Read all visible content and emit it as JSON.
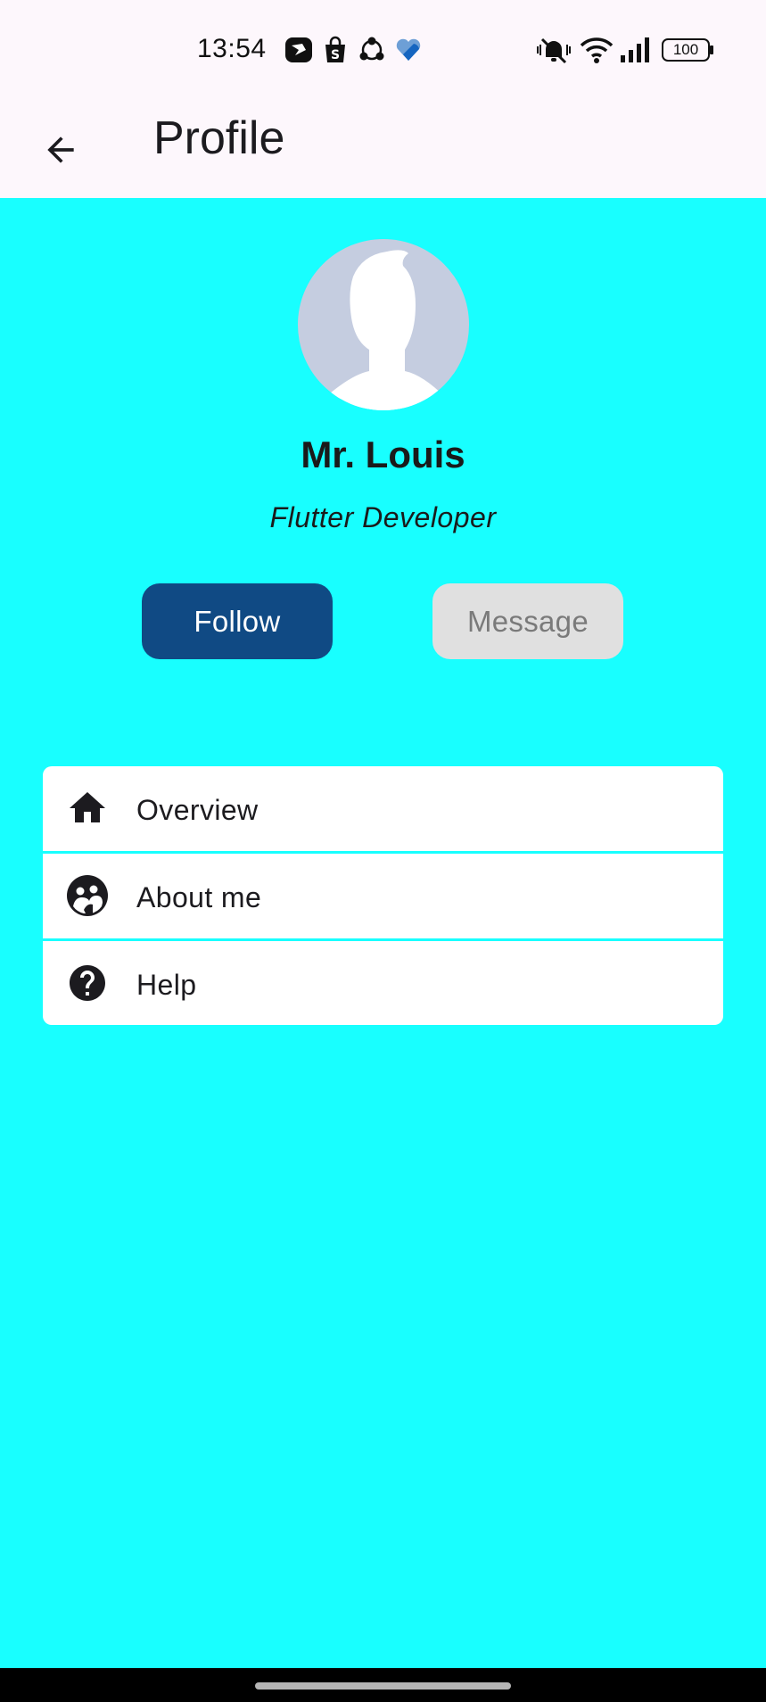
{
  "status_bar": {
    "time": "13:54",
    "notification_icons": [
      "app-notification-icon",
      "shopping-bag-icon",
      "share-hub-icon",
      "heart-app-icon"
    ],
    "right_icons": [
      "vibrate-mute-icon",
      "wifi-icon",
      "signal-icon",
      "battery-icon"
    ],
    "battery_level": "100"
  },
  "app_bar": {
    "title": "Profile",
    "back_icon": "arrow-back-icon"
  },
  "profile": {
    "name": "Mr. Louis",
    "role": "Flutter Developer",
    "avatar_icon": "person-silhouette-icon"
  },
  "actions": {
    "follow_label": "Follow",
    "message_label": "Message"
  },
  "menu": {
    "items": [
      {
        "label": "Overview",
        "icon": "home-icon"
      },
      {
        "label": "About me",
        "icon": "face-icon"
      },
      {
        "label": "Help",
        "icon": "help-icon"
      }
    ]
  },
  "colors": {
    "background": "#18FFFF",
    "app_bar": "#FDF7FC",
    "follow_button": "#104A84",
    "message_button": "#E0E0E0",
    "card": "#FFFFFF",
    "avatar_bg": "#C5CDE0"
  }
}
